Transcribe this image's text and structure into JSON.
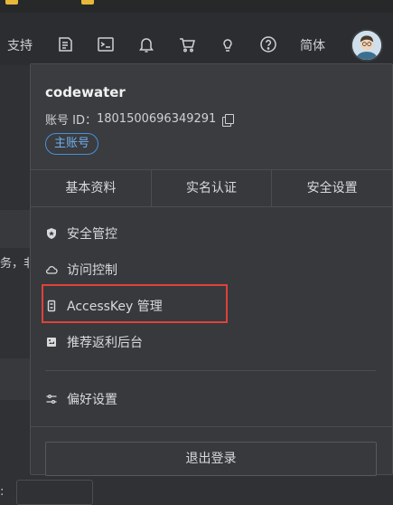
{
  "header": {
    "support_label": "支持",
    "lang_label": "简体",
    "icons": [
      "api-icon",
      "terminal-icon",
      "bell-icon",
      "cart-icon",
      "lightbulb-icon",
      "help-icon"
    ]
  },
  "user": {
    "name": "codewater",
    "account_id_label": "账号 ID：",
    "account_id": "1801500696349291",
    "badge": "主账号"
  },
  "tabs": [
    {
      "label": "基本资料"
    },
    {
      "label": "实名认证"
    },
    {
      "label": "安全设置"
    }
  ],
  "menu": {
    "items": [
      {
        "label": "安全管控",
        "icon": "shield-icon"
      },
      {
        "label": "访问控制",
        "icon": "cloud-icon"
      },
      {
        "label": "AccessKey 管理",
        "icon": "key-icon"
      },
      {
        "label": "推荐返利后台",
        "icon": "gift-icon"
      },
      {
        "label": "偏好设置",
        "icon": "sliders-icon"
      }
    ]
  },
  "logout_label": "退出登录",
  "background": {
    "partial_text": "务，非",
    "bottom_partial": ":"
  },
  "colors": {
    "accent": "#4a90d9",
    "highlight_border": "#e0413b",
    "panel_bg": "#37393c"
  }
}
